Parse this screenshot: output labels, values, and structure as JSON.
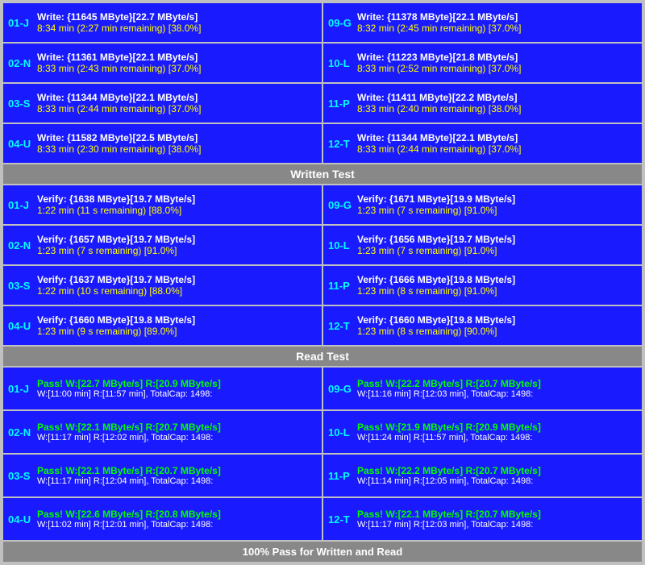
{
  "sections": {
    "write": {
      "header": "Written Test",
      "cells": [
        {
          "label": "01-J",
          "line1": "Write: {11645 MByte}[22.7 MByte/s]",
          "line2": "8:34 min (2:27 min remaining)  [38.0%]"
        },
        {
          "label": "09-G",
          "line1": "Write: {11378 MByte}[22.1 MByte/s]",
          "line2": "8:32 min (2:45 min remaining)  [37.0%]"
        },
        {
          "label": "02-N",
          "line1": "Write: {11361 MByte}[22.1 MByte/s]",
          "line2": "8:33 min (2:43 min remaining)  [37.0%]"
        },
        {
          "label": "10-L",
          "line1": "Write: {11223 MByte}[21.8 MByte/s]",
          "line2": "8:33 min (2:52 min remaining)  [37.0%]"
        },
        {
          "label": "03-S",
          "line1": "Write: {11344 MByte}[22.1 MByte/s]",
          "line2": "8:33 min (2:44 min remaining)  [37.0%]"
        },
        {
          "label": "11-P",
          "line1": "Write: {11411 MByte}[22.2 MByte/s]",
          "line2": "8:33 min (2:40 min remaining)  [38.0%]"
        },
        {
          "label": "04-U",
          "line1": "Write: {11582 MByte}[22.5 MByte/s]",
          "line2": "8:33 min (2:30 min remaining)  [38.0%]"
        },
        {
          "label": "12-T",
          "line1": "Write: {11344 MByte}[22.1 MByte/s]",
          "line2": "8:33 min (2:44 min remaining)  [37.0%]"
        }
      ]
    },
    "verify": {
      "header": "Written Test",
      "cells": [
        {
          "label": "01-J",
          "line1": "Verify: {1638 MByte}[19.7 MByte/s]",
          "line2": "1:22 min (11 s remaining)  [88.0%]"
        },
        {
          "label": "09-G",
          "line1": "Verify: {1671 MByte}[19.9 MByte/s]",
          "line2": "1:23 min (7 s remaining)  [91.0%]"
        },
        {
          "label": "02-N",
          "line1": "Verify: {1657 MByte}[19.7 MByte/s]",
          "line2": "1:23 min (7 s remaining)  [91.0%]"
        },
        {
          "label": "10-L",
          "line1": "Verify: {1656 MByte}[19.7 MByte/s]",
          "line2": "1:23 min (7 s remaining)  [91.0%]"
        },
        {
          "label": "03-S",
          "line1": "Verify: {1637 MByte}[19.7 MByte/s]",
          "line2": "1:22 min (10 s remaining)  [88.0%]"
        },
        {
          "label": "11-P",
          "line1": "Verify: {1666 MByte}[19.8 MByte/s]",
          "line2": "1:23 min (8 s remaining)  [91.0%]"
        },
        {
          "label": "04-U",
          "line1": "Verify: {1660 MByte}[19.8 MByte/s]",
          "line2": "1:23 min (9 s remaining)  [89.0%]"
        },
        {
          "label": "12-T",
          "line1": "Verify: {1660 MByte}[19.8 MByte/s]",
          "line2": "1:23 min (8 s remaining)  [90.0%]"
        }
      ]
    },
    "read": {
      "header": "Read Test",
      "cells": [
        {
          "label": "01-J",
          "line1": "Pass! W:[22.7 MByte/s] R:[20.9 MByte/s]",
          "line2": "W:[11:00 min] R:[11:57 min], TotalCap: 1498:"
        },
        {
          "label": "09-G",
          "line1": "Pass! W:[22.2 MByte/s] R:[20.7 MByte/s]",
          "line2": "W:[11:16 min] R:[12:03 min], TotalCap: 1498:"
        },
        {
          "label": "02-N",
          "line1": "Pass! W:[22.1 MByte/s] R:[20.7 MByte/s]",
          "line2": "W:[11:17 min] R:[12:02 min], TotalCap: 1498:"
        },
        {
          "label": "10-L",
          "line1": "Pass! W:[21.9 MByte/s] R:[20.9 MByte/s]",
          "line2": "W:[11:24 min] R:[11:57 min], TotalCap: 1498:"
        },
        {
          "label": "03-S",
          "line1": "Pass! W:[22.1 MByte/s] R:[20.7 MByte/s]",
          "line2": "W:[11:17 min] R:[12:04 min], TotalCap: 1498:"
        },
        {
          "label": "11-P",
          "line1": "Pass! W:[22.2 MByte/s] R:[20.7 MByte/s]",
          "line2": "W:[11:14 min] R:[12:05 min], TotalCap: 1498:"
        },
        {
          "label": "04-U",
          "line1": "Pass! W:[22.6 MByte/s] R:[20.8 MByte/s]",
          "line2": "W:[11:02 min] R:[12:01 min], TotalCap: 1498:"
        },
        {
          "label": "12-T",
          "line1": "Pass! W:[22.1 MByte/s] R:[20.7 MByte/s]",
          "line2": "W:[11:17 min] R:[12:03 min], TotalCap: 1498:"
        }
      ]
    }
  },
  "headers": {
    "written_test": "Written Test",
    "read_test": "Read Test"
  },
  "footer": {
    "text": "100% Pass for Written and Read"
  }
}
